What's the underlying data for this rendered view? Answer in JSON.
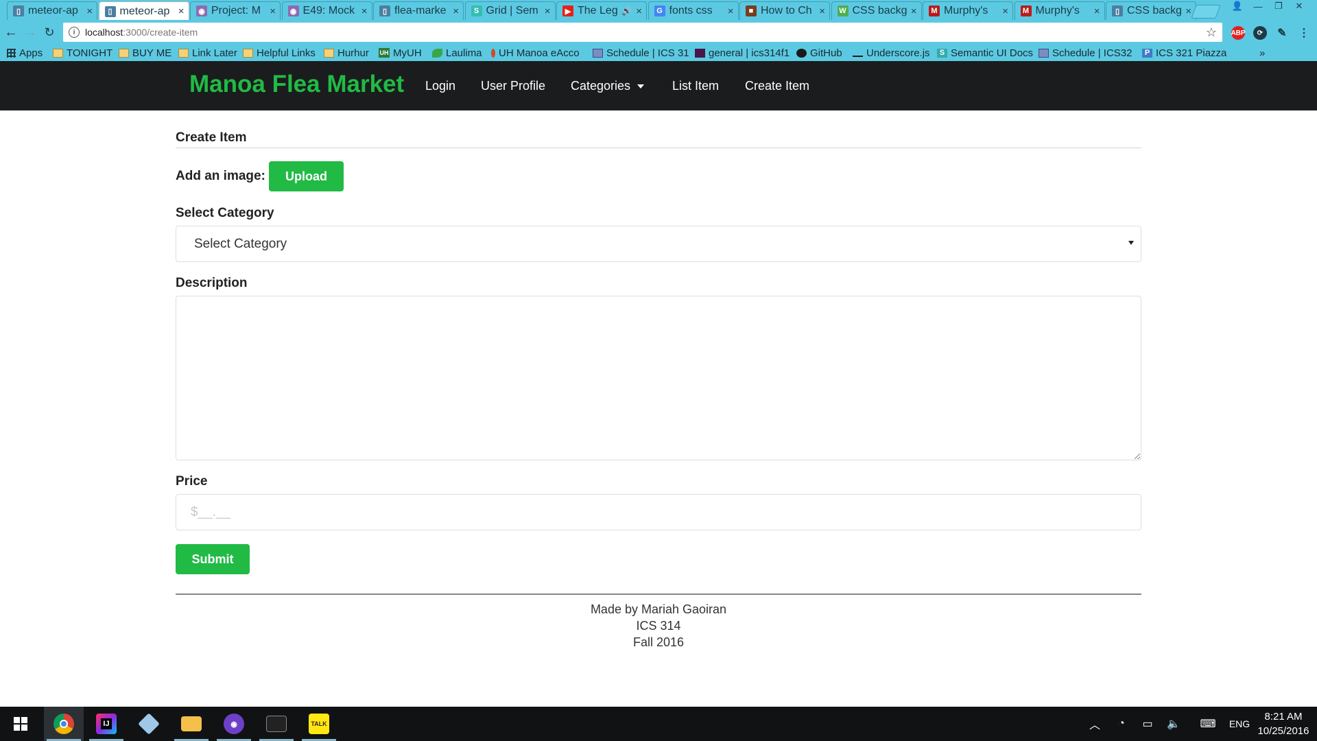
{
  "browser": {
    "tabs": [
      {
        "label": "meteor-ap",
        "icon": "document-icon"
      },
      {
        "label": "meteor-ap",
        "icon": "document-icon",
        "active": true
      },
      {
        "label": "Project: M",
        "icon": "project-icon"
      },
      {
        "label": "E49: Mock",
        "icon": "project-icon"
      },
      {
        "label": "flea-marke",
        "icon": "document-icon"
      },
      {
        "label": "Grid | Sem",
        "icon": "semantic-icon"
      },
      {
        "label": "The Leg",
        "icon": "youtube-icon"
      },
      {
        "label": "fonts css",
        "icon": "google-icon"
      },
      {
        "label": "How to Ch",
        "icon": "site-icon"
      },
      {
        "label": "CSS backg",
        "icon": "w3-icon"
      },
      {
        "label": "Murphy's",
        "icon": "murphys-icon"
      },
      {
        "label": "Murphy's",
        "icon": "murphys-icon"
      },
      {
        "label": "CSS backg",
        "icon": "document-icon"
      }
    ],
    "address": {
      "host": "localhost",
      "path": ":3000/create-item"
    },
    "bookmarks": [
      {
        "label": "Apps",
        "icon": "grid"
      },
      {
        "label": "TONIGHT",
        "icon": "folder"
      },
      {
        "label": "BUY ME",
        "icon": "folder"
      },
      {
        "label": "Link Later",
        "icon": "folder"
      },
      {
        "label": "Helpful Links",
        "icon": "folder"
      },
      {
        "label": "Hurhur",
        "icon": "folder"
      },
      {
        "label": "MyUH",
        "icon": "uh"
      },
      {
        "label": "Laulima",
        "icon": "leaf"
      },
      {
        "label": "UH Manoa eAcco",
        "icon": "red"
      },
      {
        "label": "Schedule | ICS 31",
        "icon": "sq"
      },
      {
        "label": "general | ics314f1",
        "icon": "slack"
      },
      {
        "label": "GitHub",
        "icon": "gh"
      },
      {
        "label": "Underscore.js",
        "icon": "us"
      },
      {
        "label": "Semantic UI Docs",
        "icon": "s"
      },
      {
        "label": "Schedule | ICS32",
        "icon": "sq"
      },
      {
        "label": "ICS 321 Piazza",
        "icon": "p"
      }
    ],
    "bookmarks_overflow": "»"
  },
  "site": {
    "brand": "Manoa Flea Market",
    "nav": {
      "login": "Login",
      "user_profile": "User Profile",
      "categories": "Categories",
      "list_item": "List Item",
      "create_item": "Create Item"
    },
    "accent_color": "#21ba45"
  },
  "form": {
    "title": "Create Item",
    "image_label": "Add an image:",
    "upload_label": "Upload",
    "category_label": "Select Category",
    "category_selected": "Select Category",
    "description_label": "Description",
    "description_value": "",
    "price_label": "Price",
    "price_placeholder": "$__.__",
    "submit_label": "Submit"
  },
  "footer": {
    "line1": "Made by Mariah Gaoiran",
    "line2": "ICS 314",
    "line3": "Fall 2016"
  },
  "taskbar": {
    "language": "ENG",
    "time": "8:21 AM",
    "date": "10/25/2016"
  }
}
